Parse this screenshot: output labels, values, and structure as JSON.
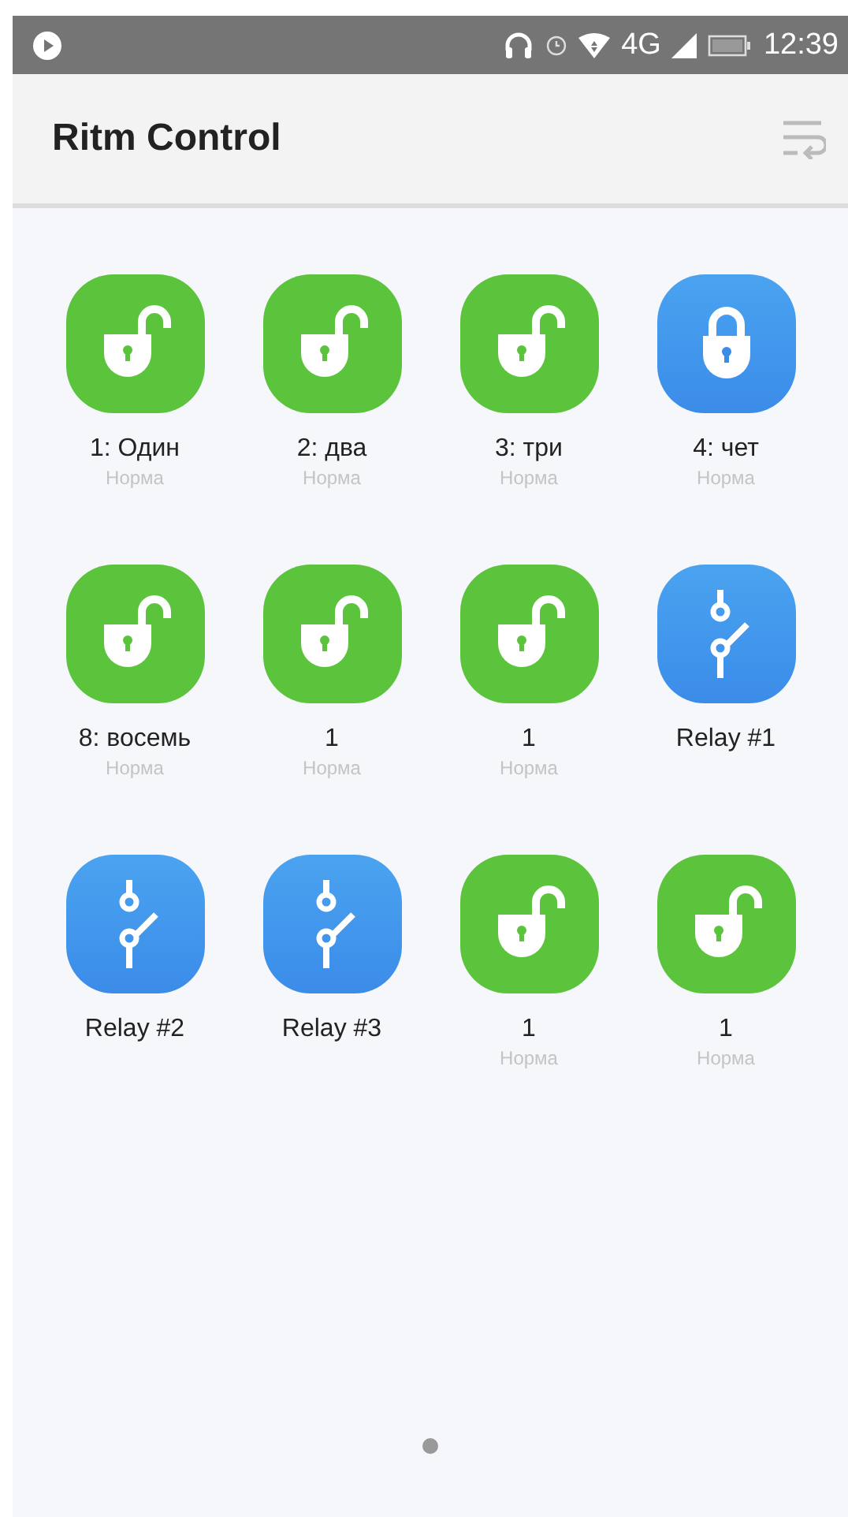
{
  "status_bar": {
    "network": "4G",
    "time": "12:39"
  },
  "app_bar": {
    "title": "Ritm Control"
  },
  "devices": [
    {
      "kind": "lock",
      "locked": false,
      "name": "1: Один",
      "status": "Норма"
    },
    {
      "kind": "lock",
      "locked": false,
      "name": "2: два",
      "status": "Норма"
    },
    {
      "kind": "lock",
      "locked": false,
      "name": "3: три",
      "status": "Норма"
    },
    {
      "kind": "lock",
      "locked": true,
      "name": "4: чет",
      "status": "Норма"
    },
    {
      "kind": "lock",
      "locked": false,
      "name": "8: восемь",
      "status": "Норма"
    },
    {
      "kind": "lock",
      "locked": false,
      "name": "1",
      "status": "Норма"
    },
    {
      "kind": "lock",
      "locked": false,
      "name": "1",
      "status": "Норма"
    },
    {
      "kind": "relay",
      "name": "Relay #1"
    },
    {
      "kind": "relay",
      "name": "Relay #2"
    },
    {
      "kind": "relay",
      "name": "Relay #3"
    },
    {
      "kind": "lock",
      "locked": false,
      "name": "1",
      "status": "Норма"
    },
    {
      "kind": "lock",
      "locked": false,
      "name": "1",
      "status": "Норма"
    }
  ],
  "pager": [
    {
      "selected": true
    }
  ]
}
